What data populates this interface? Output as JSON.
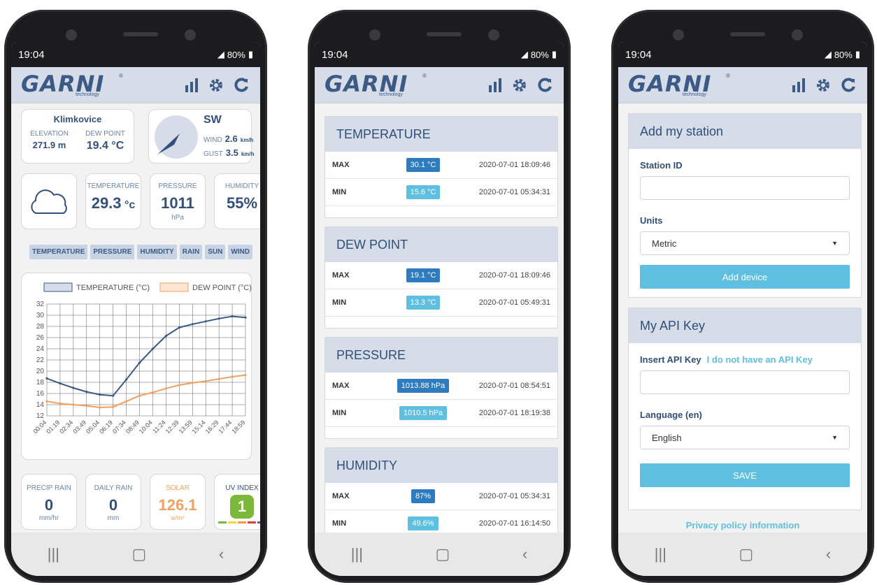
{
  "status": {
    "time": "19:04",
    "battery": "80%"
  },
  "brand": {
    "logo": "GARNI",
    "sub": "technology",
    "reg": "®"
  },
  "screen1": {
    "location": {
      "name": "Klimkovice",
      "elev_label": "ELEVATION",
      "elev": "271.9 m",
      "dew_label": "DEW POINT",
      "dew": "19.4 °C"
    },
    "wind": {
      "dir": "SW",
      "wind_label": "WIND",
      "wind_val": "2.6",
      "unit": "km/h",
      "gust_label": "GUST",
      "gust_val": "3.5",
      "gust_unit": "km/h"
    },
    "temp": {
      "label": "TEMPERATURE",
      "value": "29.3",
      "unit": "°c"
    },
    "press": {
      "label": "PRESSURE",
      "value": "1011",
      "unit": "hPa"
    },
    "hum": {
      "label": "HUMIDITY",
      "value": "55%"
    },
    "tabs": [
      "TEMPERATURE",
      "PRESSURE",
      "HUMIDITY",
      "RAIN",
      "SUN",
      "WIND"
    ],
    "precip": {
      "label": "PRECIP RAIN",
      "value": "0",
      "unit": "mm/hr"
    },
    "daily": {
      "label": "DAILY RAIN",
      "value": "0",
      "unit": "mm"
    },
    "solar": {
      "label": "SOLAR",
      "value": "126.1",
      "unit": "w/m²"
    },
    "uv": {
      "label": "UV INDEX",
      "value": "1"
    }
  },
  "chart_data": {
    "type": "line",
    "x": [
      "00:04",
      "01:19",
      "02:34",
      "03:49",
      "05:04",
      "06:19",
      "07:34",
      "08:49",
      "10:04",
      "11:24",
      "12:39",
      "13:59",
      "15:14",
      "16:29",
      "17:44",
      "18:59"
    ],
    "series": [
      {
        "name": "TEMPERATURE (°C)",
        "color": "#3b5a86",
        "values": [
          18.7,
          17.8,
          17.0,
          16.3,
          15.8,
          15.6,
          18.5,
          21.5,
          24.0,
          26.3,
          27.8,
          28.4,
          28.9,
          29.4,
          29.8,
          29.6
        ]
      },
      {
        "name": "DEW POINT (°C)",
        "color": "#f0a060",
        "values": [
          14.6,
          14.2,
          14.0,
          13.8,
          13.5,
          13.6,
          14.6,
          15.6,
          16.2,
          16.9,
          17.5,
          17.9,
          18.2,
          18.6,
          19.0,
          19.3
        ]
      }
    ],
    "yticks": [
      "32",
      "30",
      "28",
      "26",
      "24",
      "22",
      "20",
      "18",
      "16",
      "14",
      "12"
    ],
    "ylim": [
      12,
      32
    ]
  },
  "screen2": {
    "sections": [
      {
        "title": "TEMPERATURE",
        "rows": [
          {
            "k": "MAX",
            "v": "30.1 °C",
            "ts": "2020-07-01 18:09:46",
            "c": "#2f7bc0"
          },
          {
            "k": "MIN",
            "v": "15.6 °C",
            "ts": "2020-07-01 05:34:31",
            "c": "#5ebfe0"
          }
        ]
      },
      {
        "title": "DEW POINT",
        "rows": [
          {
            "k": "MAX",
            "v": "19.1 °C",
            "ts": "2020-07-01 18:09:46",
            "c": "#2f7bc0"
          },
          {
            "k": "MIN",
            "v": "13.3 °C",
            "ts": "2020-07-01 05:49:31",
            "c": "#5ebfe0"
          }
        ]
      },
      {
        "title": "PRESSURE",
        "rows": [
          {
            "k": "MAX",
            "v": "1013.88 hPa",
            "ts": "2020-07-01 08:54:51",
            "c": "#2f7bc0"
          },
          {
            "k": "MIN",
            "v": "1010.5 hPa",
            "ts": "2020-07-01 18:19:38",
            "c": "#5ebfe0"
          }
        ]
      },
      {
        "title": "HUMIDITY",
        "rows": [
          {
            "k": "MAX",
            "v": "87%",
            "ts": "2020-07-01 05:34:31",
            "c": "#2f7bc0"
          },
          {
            "k": "MIN",
            "v": "49.6%",
            "ts": "2020-07-01 16:14:50",
            "c": "#5ebfe0"
          }
        ]
      }
    ]
  },
  "screen3": {
    "add_title": "Add my station",
    "station_label": "Station ID",
    "station_value": "",
    "units_label": "Units",
    "units_value": "Metric",
    "add_btn": "Add device",
    "api_title": "My API Key",
    "api_label": "Insert API Key",
    "api_link": "I do not have an API Key",
    "api_value": "",
    "lang_label": "Language  (en)",
    "lang_value": "English",
    "save_btn": "SAVE",
    "privacy": "Privacy policy information"
  }
}
